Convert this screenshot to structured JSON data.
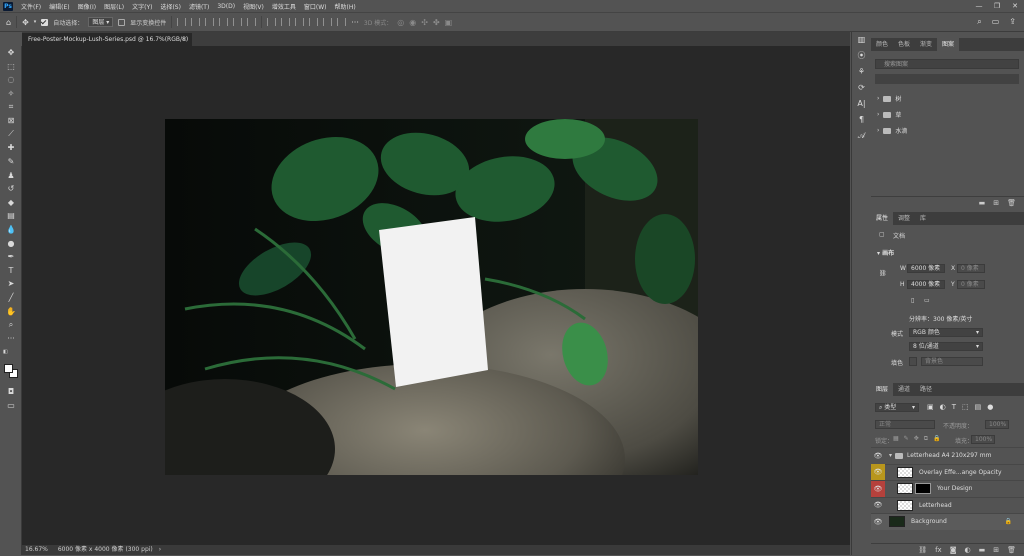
{
  "menu": {
    "logo": "Ps",
    "items": [
      "文件(F)",
      "编辑(E)",
      "图像(I)",
      "图层(L)",
      "文字(Y)",
      "选择(S)",
      "滤镜(T)",
      "3D(D)",
      "视图(V)",
      "增效工具",
      "窗口(W)",
      "帮助(H)"
    ],
    "window_controls": [
      "—",
      "❐",
      "✕"
    ]
  },
  "options": {
    "auto_select_label": "自动选择：",
    "auto_select_target": "图层",
    "show_transform_label": "显示变换控件",
    "more": "···",
    "mode_3d_label": "3D 模式："
  },
  "document": {
    "tab_title": "Free-Poster-Mockup-Lush-Series.psd @ 16.7%(RGB/8)",
    "close": "×"
  },
  "status": {
    "zoom": "16.67%",
    "info": "6000 像素 x 4000 像素 (300 ppi)",
    "arrow": "›"
  },
  "panels": {
    "top_tabs": [
      "颜色",
      "色板",
      "渐变",
      "图案"
    ],
    "search_placeholder": "搜索图案",
    "library_items": [
      "树",
      "草",
      "水滴"
    ],
    "props_tabs": [
      "属性",
      "调整",
      "库"
    ],
    "doc_label": "文档",
    "canvas_section": "画布",
    "width_label": "W",
    "width_value": "6000 像素",
    "height_label": "H",
    "height_value": "4000 像素",
    "x_label": "X",
    "x_value": "0 像素",
    "y_label": "Y",
    "y_value": "0 像素",
    "resolution": "分辨率：300 像素/英寸",
    "mode_label": "模式",
    "mode_value": "RGB 颜色",
    "depth_value": "8 位/通道",
    "fill_label": "填色",
    "fill_value": "背景色"
  },
  "layers": {
    "tabs": [
      "图层",
      "通道",
      "路径"
    ],
    "filter_kind": "类型",
    "blend_mode": "正常",
    "opacity_label": "不透明度：",
    "opacity_value": "100%",
    "lock_label": "锁定：",
    "fill_label": "填充：",
    "fill_value": "100%",
    "items": [
      {
        "name": "Letterhead A4 210x297 mm",
        "group": true
      },
      {
        "name": "Overlay Effe...ange Opacity"
      },
      {
        "name": "Your Design"
      },
      {
        "name": "Letterhead"
      },
      {
        "name": "Background"
      }
    ]
  },
  "colors": {
    "eye_yellow": "#b8961c",
    "eye_red": "#b5413c",
    "canvas_bg": "#282828",
    "panel_bg": "#535353"
  }
}
